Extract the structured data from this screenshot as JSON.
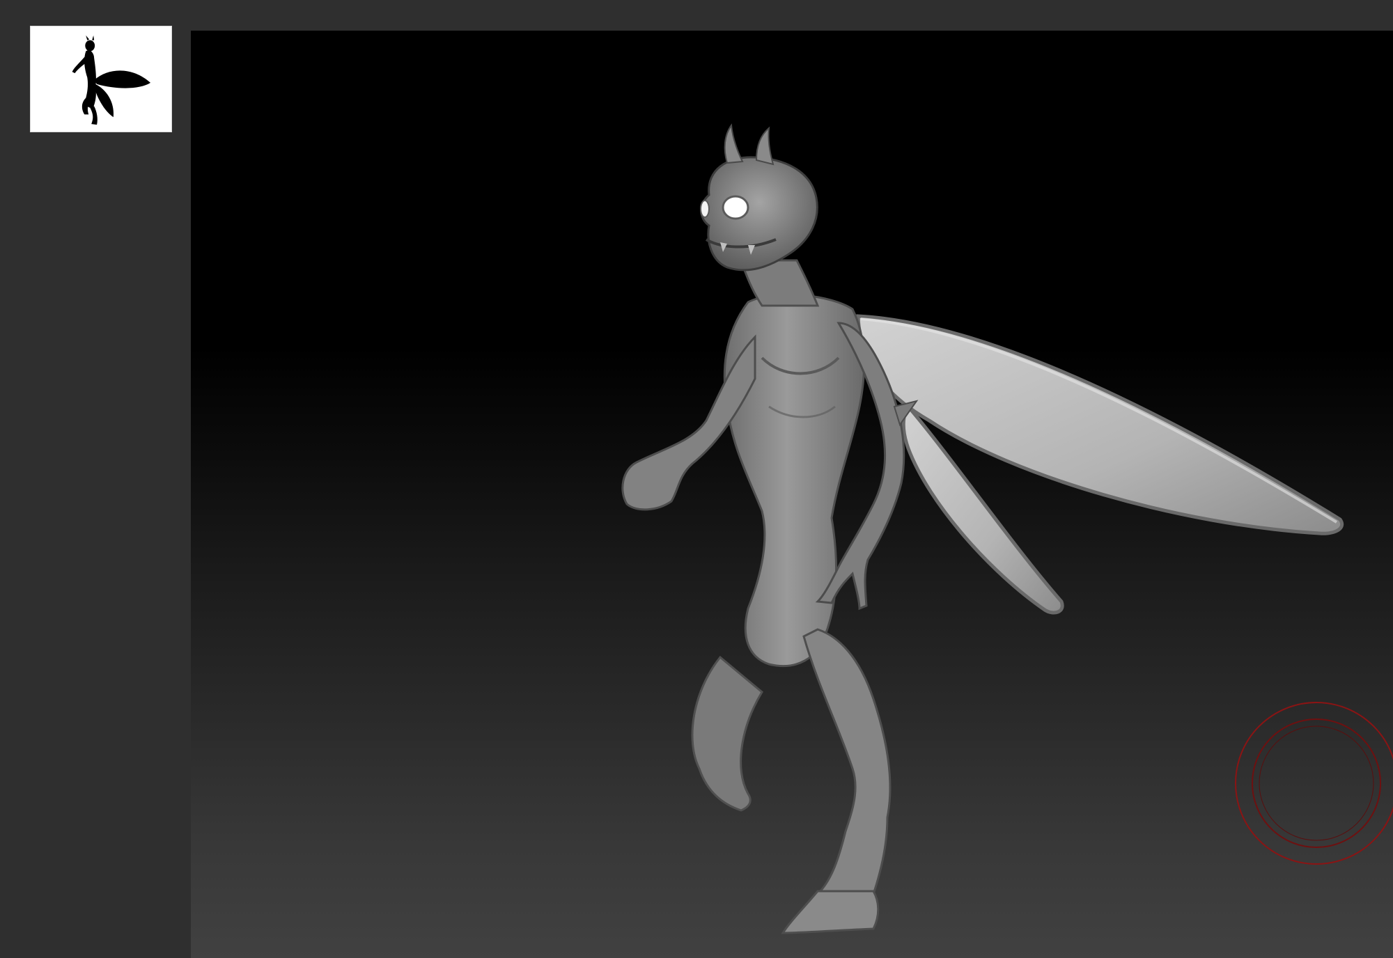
{
  "app": {
    "viewport_background_top": "#000000",
    "viewport_background_bottom": "#414141",
    "panel_color": "#2f2f2f"
  },
  "thumbnail": {
    "icon": "fairy-silhouette-icon",
    "background": "#ffffff",
    "silhouette_color": "#000000"
  },
  "model": {
    "subject": "winged-creature-sculpt",
    "material_color": "#8a8a8a",
    "eye_color": "#ffffff"
  },
  "gizmo": {
    "icon": "rotation-gizmo-icon",
    "color": "#8b1414"
  }
}
